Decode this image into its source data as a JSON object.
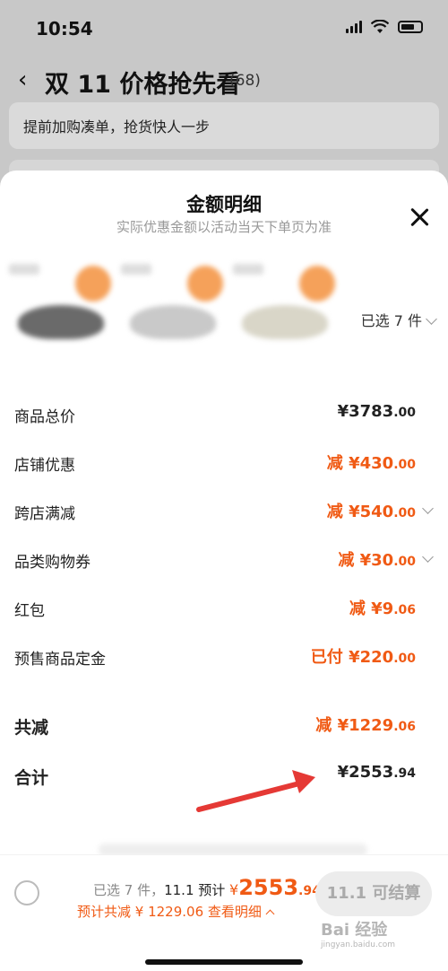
{
  "status_bar": {
    "time": "10:54"
  },
  "header": {
    "back_icon": "chevron-left-icon",
    "title": "双 11 价格抢先看",
    "count": "(68)"
  },
  "banner": {
    "text": "提前加购凑单，抢货快人一步"
  },
  "sheet": {
    "title": "金额明细",
    "subtitle": "实际优惠金额以活动当天下单页为准",
    "selected_label": "已选 7 件"
  },
  "breakdown": [
    {
      "label": "商品总价",
      "prefix": "",
      "amount": "¥3783",
      "cents": ".00",
      "color": "#222222",
      "expandable": false
    },
    {
      "label": "店铺优惠",
      "prefix": "减 ",
      "amount": "¥430",
      "cents": ".00",
      "color": "#f05a14",
      "expandable": false
    },
    {
      "label": "跨店满减",
      "prefix": "减 ",
      "amount": "¥540",
      "cents": ".00",
      "color": "#f05a14",
      "expandable": true
    },
    {
      "label": "品类购物券",
      "prefix": "减 ",
      "amount": "¥30",
      "cents": ".00",
      "color": "#f05a14",
      "expandable": true
    },
    {
      "label": "红包",
      "prefix": "减 ",
      "amount": "¥9",
      "cents": ".06",
      "color": "#f05a14",
      "expandable": false
    },
    {
      "label": "预售商品定金",
      "prefix": "已付 ",
      "amount": "¥220",
      "cents": ".00",
      "color": "#f05a14",
      "expandable": false
    }
  ],
  "totals": {
    "discount_label": "共减",
    "discount_prefix": "减 ",
    "discount_amount": "¥1229",
    "discount_cents": ".06",
    "total_label": "合计",
    "total_amount": "¥2553",
    "total_cents": ".94"
  },
  "bottom_bar": {
    "selected_text": "已选 7 件，",
    "presale_label": "11.1 预计",
    "currency": "¥",
    "price_int": "2553",
    "price_cents": ".94",
    "discount_text": "预计共减 ¥ 1229.06",
    "details_link": "查看明细",
    "checkout_label": "11.1 可结算"
  },
  "colors": {
    "accent": "#f05a14",
    "arrow": "#e53935"
  },
  "watermark": {
    "text": "Bai 经验",
    "sub": "jingyan.baidu.com"
  }
}
